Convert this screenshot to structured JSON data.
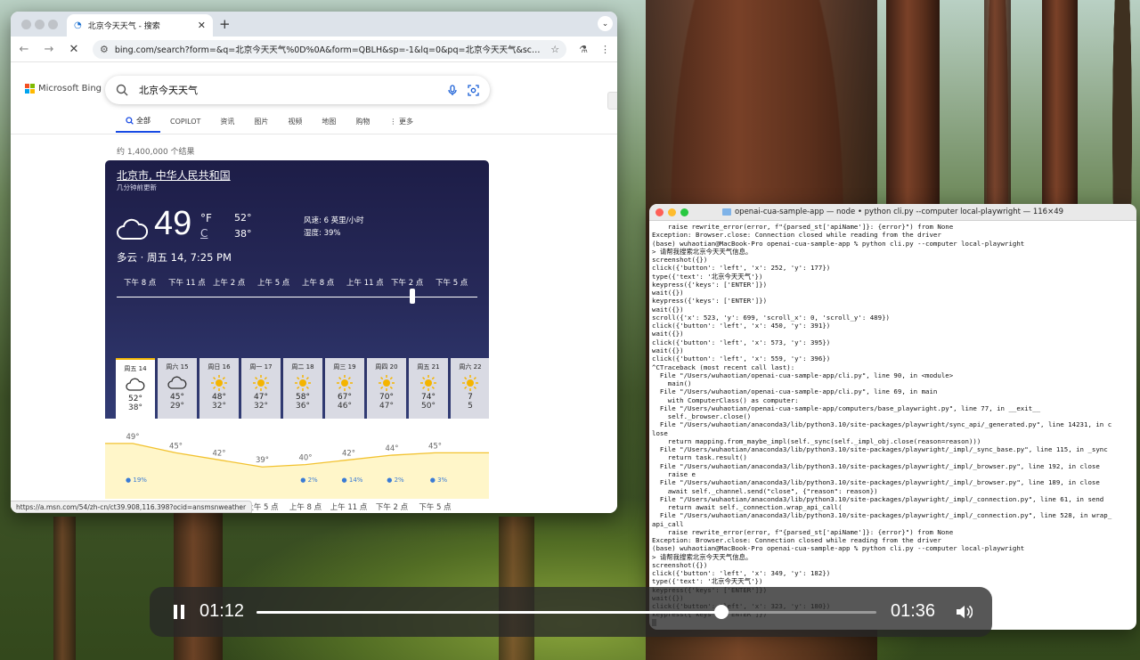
{
  "browser": {
    "tab_title": "北京今天天气 - 搜索",
    "new_tab": "+",
    "url": "bing.com/search?form=&q=北京今天天气%0D%0A&form=QBLH&sp=-1&lq=0&pq=北京今天天气&sc=12-7&q...",
    "status_url": "https://a.msn.com/54/zh-cn/ct39.908,116.398?ocid=ansmsnweather"
  },
  "bing": {
    "logo": "Microsoft Bing",
    "query": "北京今天天气",
    "scopes": [
      "全部",
      "COPILOT",
      "资讯",
      "图片",
      "视频",
      "地图",
      "购物",
      "⋮ 更多"
    ],
    "active_scope": "全部",
    "result_count": "约 1,400,000 个结果"
  },
  "weather": {
    "city": "北京市, 中华人民共和国",
    "updated": "几分钟前更新",
    "temp": "49",
    "unit_f": "°F",
    "unit_c": "C",
    "hi": "52°",
    "lo": "38°",
    "wind": "风速: 6 英里/小时",
    "humidity": "湿度: 39%",
    "condition": "多云 · 周五 14, 7:25 PM",
    "hours": [
      "下午 8 点",
      "下午 11 点",
      "上午 2 点",
      "上午 5 点",
      "上午 8 点",
      "上午 11 点",
      "下午 2 点",
      "下午 5 点"
    ],
    "timeline_position": 0.82,
    "days": [
      {
        "label": "周五 14",
        "icon": "cloud-icon",
        "hi": "52°",
        "lo": "38°"
      },
      {
        "label": "周六 15",
        "icon": "cloud-icon",
        "hi": "45°",
        "lo": "29°"
      },
      {
        "label": "周日 16",
        "icon": "sun-icon",
        "hi": "48°",
        "lo": "32°"
      },
      {
        "label": "周一 17",
        "icon": "sun-icon",
        "hi": "47°",
        "lo": "32°"
      },
      {
        "label": "周二 18",
        "icon": "sun-icon",
        "hi": "58°",
        "lo": "36°"
      },
      {
        "label": "周三 19",
        "icon": "sun-icon",
        "hi": "67°",
        "lo": "46°"
      },
      {
        "label": "周四 20",
        "icon": "sun-icon",
        "hi": "70°",
        "lo": "47°"
      },
      {
        "label": "周五 21",
        "icon": "sun-icon",
        "hi": "74°",
        "lo": "50°"
      },
      {
        "label": "周六 22",
        "icon": "sun-icon",
        "hi": "7",
        "lo": "5"
      }
    ]
  },
  "chart_data": {
    "type": "area",
    "categories": [
      "下午 8 点",
      "下午 11 点",
      "上午 2 点",
      "上午 5 点",
      "上午 8 点",
      "上午 11 点",
      "下午 2 点",
      "下午 5 点"
    ],
    "temps": [
      49,
      45,
      42,
      39,
      40,
      42,
      44,
      45
    ],
    "temp_labels": [
      "49°",
      "45°",
      "42°",
      "39°",
      "40°",
      "42°",
      "44°",
      "45°"
    ],
    "precip": [
      "19%",
      "",
      "",
      "",
      "2%",
      "14%",
      "2%",
      "3%"
    ],
    "ylim": [
      30,
      55
    ]
  },
  "terminal": {
    "title": "openai-cua-sample-app — node • python cli.py --computer local-playwright — 116×49",
    "lines": [
      "    raise rewrite_error(error, f\"{parsed_st['apiName']}: {error}\") from None",
      "Exception: Browser.close: Connection closed while reading from the driver",
      "(base) wuhaotian@MacBook-Pro openai-cua-sample-app % python cli.py --computer local-playwright",
      "> 请帮我搜索北京今天天气信息。",
      "screenshot({})",
      "click({'button': 'left', 'x': 252, 'y': 177})",
      "type({'text': '北京今天天气'})",
      "keypress({'keys': ['ENTER']})",
      "wait({})",
      "keypress({'keys': ['ENTER']})",
      "wait({})",
      "scroll({'x': 523, 'y': 699, 'scroll_x': 0, 'scroll_y': 489})",
      "click({'button': 'left', 'x': 450, 'y': 391})",
      "wait({})",
      "click({'button': 'left', 'x': 573, 'y': 395})",
      "wait({})",
      "click({'button': 'left', 'x': 559, 'y': 396})",
      "^CTraceback (most recent call last):",
      "  File \"/Users/wuhaotian/openai-cua-sample-app/cli.py\", line 90, in <module>",
      "    main()",
      "  File \"/Users/wuhaotian/openai-cua-sample-app/cli.py\", line 69, in main",
      "    with ComputerClass() as computer:",
      "  File \"/Users/wuhaotian/openai-cua-sample-app/computers/base_playwright.py\", line 77, in __exit__",
      "    self._browser.close()",
      "  File \"/Users/wuhaotian/anaconda3/lib/python3.10/site-packages/playwright/sync_api/_generated.py\", line 14231, in c",
      "lose",
      "    return mapping.from_maybe_impl(self._sync(self._impl_obj.close(reason=reason)))",
      "  File \"/Users/wuhaotian/anaconda3/lib/python3.10/site-packages/playwright/_impl/_sync_base.py\", line 115, in _sync",
      "    return task.result()",
      "  File \"/Users/wuhaotian/anaconda3/lib/python3.10/site-packages/playwright/_impl/_browser.py\", line 192, in close",
      "    raise e",
      "  File \"/Users/wuhaotian/anaconda3/lib/python3.10/site-packages/playwright/_impl/_browser.py\", line 189, in close",
      "    await self._channel.send(\"close\", {\"reason\": reason})",
      "  File \"/Users/wuhaotian/anaconda3/lib/python3.10/site-packages/playwright/_impl/_connection.py\", line 61, in send",
      "    return await self._connection.wrap_api_call(",
      "  File \"/Users/wuhaotian/anaconda3/lib/python3.10/site-packages/playwright/_impl/_connection.py\", line 528, in wrap_",
      "api_call",
      "    raise rewrite_error(error, f\"{parsed_st['apiName']}: {error}\") from None",
      "Exception: Browser.close: Connection closed while reading from the driver",
      "(base) wuhaotian@MacBook-Pro openai-cua-sample-app % python cli.py --computer local-playwright",
      "> 请帮我搜索北京今天天气信息。",
      "screenshot({})",
      "click({'button': 'left', 'x': 349, 'y': 182})",
      "type({'text': '北京今天天气'})",
      "keypress({'keys': ['ENTER']})",
      "wait({})",
      "click({'button': 'left', 'x': 323, 'y': 180})",
      "keypress({'keys': ['ENTER']})"
    ]
  },
  "player": {
    "current": "01:12",
    "duration": "01:36",
    "progress": 0.75
  }
}
